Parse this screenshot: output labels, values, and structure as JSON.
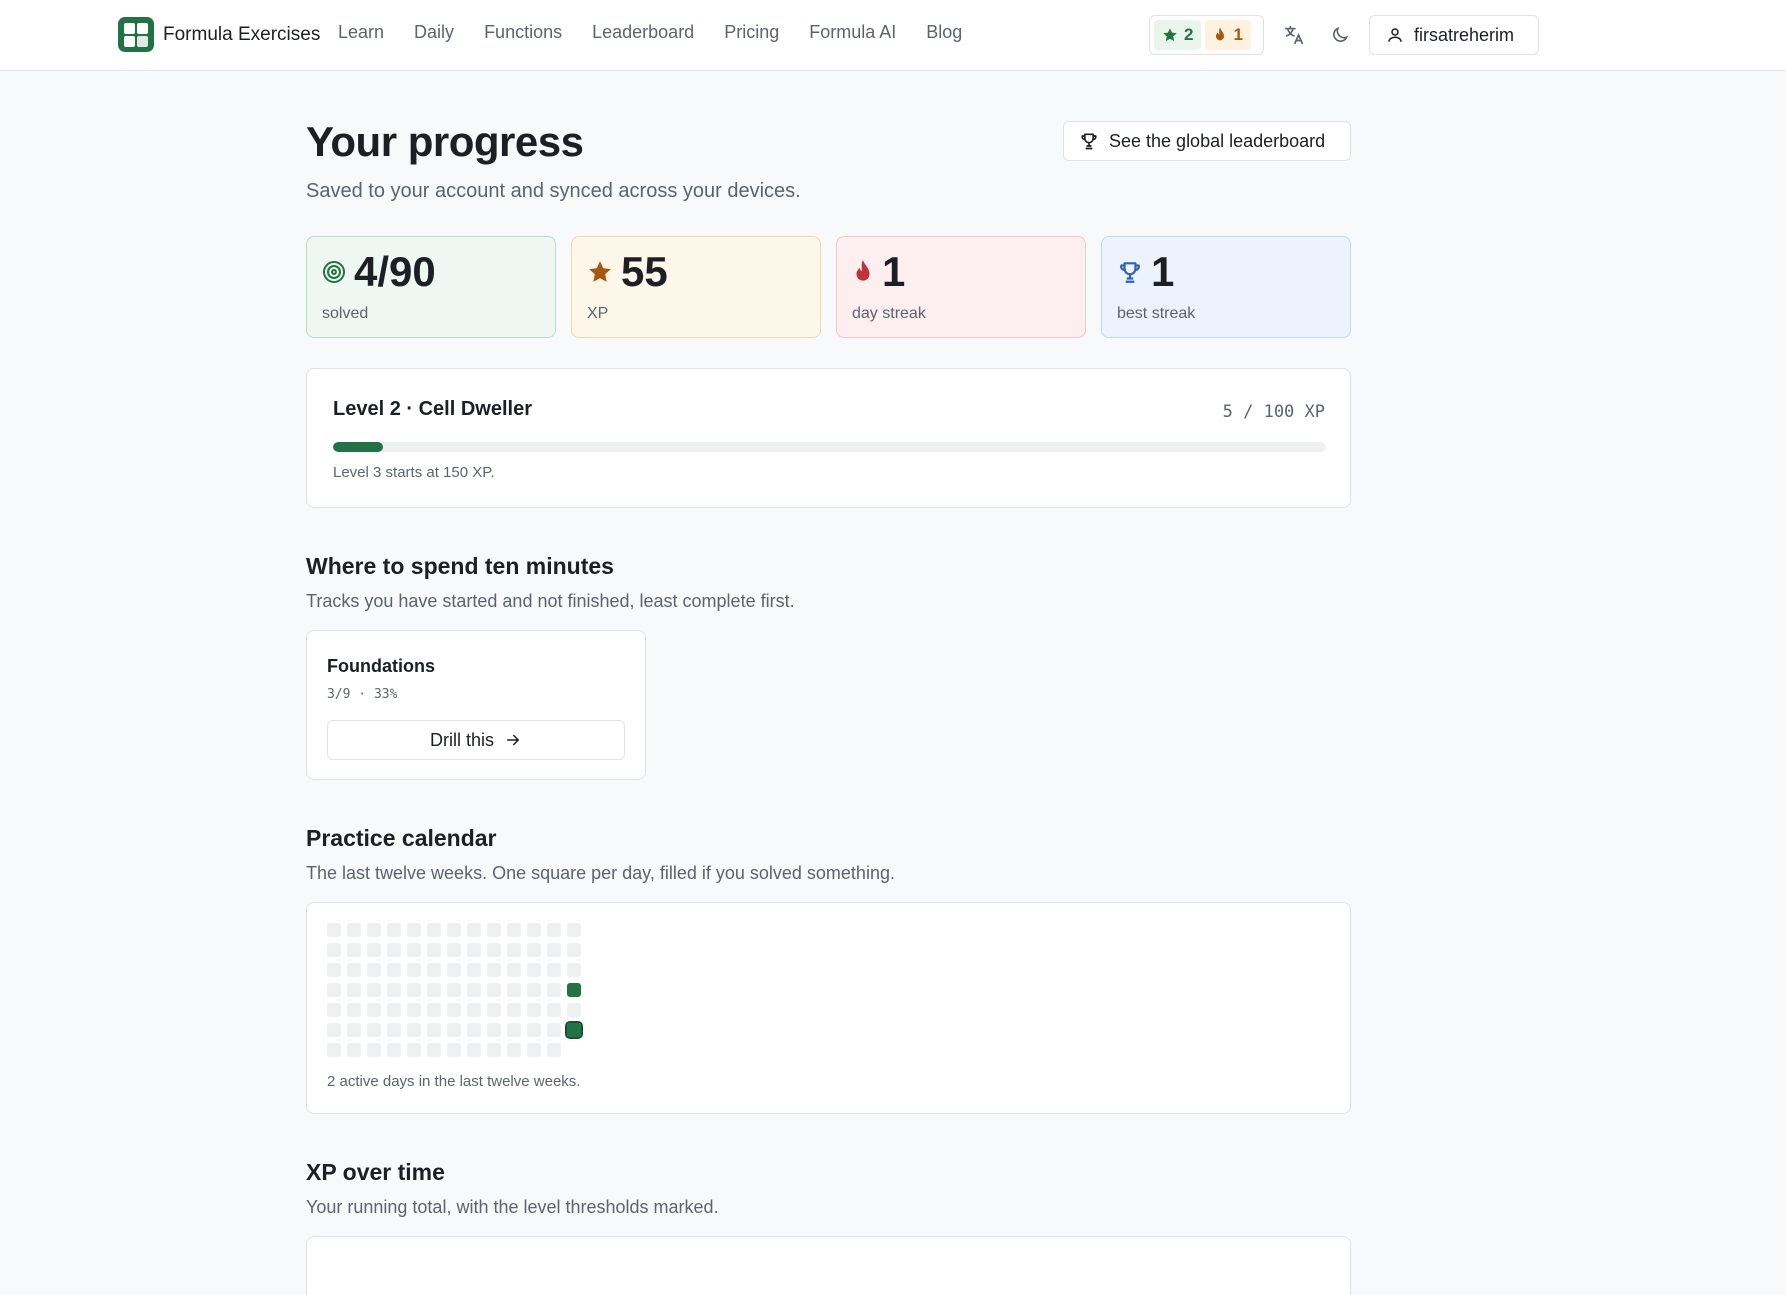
{
  "header": {
    "brand": "Formula Exercises",
    "nav": [
      "Learn",
      "Daily",
      "Functions",
      "Leaderboard",
      "Pricing",
      "Formula AI",
      "Blog"
    ],
    "stars": "2",
    "streak": "1",
    "username": "firsatreherim",
    "icons": [
      "star-icon",
      "flame-icon",
      "translate-icon",
      "moon-icon",
      "user-icon"
    ]
  },
  "page": {
    "title": "Your progress",
    "subtitle": "Saved to your account and synced across your devices.",
    "leaderboard_button": "See the global leaderboard"
  },
  "stats": [
    {
      "value": "4/90",
      "label": "solved",
      "icon": "target-icon"
    },
    {
      "value": "55",
      "label": "XP",
      "icon": "star-icon"
    },
    {
      "value": "1",
      "label": "day streak",
      "icon": "flame-icon"
    },
    {
      "value": "1",
      "label": "best streak",
      "icon": "trophy-icon"
    }
  ],
  "level": {
    "title": "Level 2 · Cell Dweller",
    "xp": "5 / 100 XP",
    "progress": 0.05,
    "note": "Level 3 starts at 150 XP."
  },
  "spend": {
    "title": "Where to spend ten minutes",
    "subtitle": "Tracks you have started and not finished, least complete first.",
    "track": {
      "name": "Foundations",
      "meta": "3/9 · 33%",
      "button": "Drill this"
    }
  },
  "calendar": {
    "title": "Practice calendar",
    "subtitle": "The last twelve weeks. One square per day, filled if you solved something.",
    "weeks": 13,
    "active": [
      {
        "week": 12,
        "day": 3
      },
      {
        "week": 12,
        "day": 5,
        "today": true
      }
    ],
    "last_week_days": 6,
    "note": "2 active days in the last twelve weeks."
  },
  "xp_over_time": {
    "title": "XP over time",
    "subtitle": "Your running total, with the level thresholds marked."
  },
  "colors": {
    "accent": "#217346",
    "xp": "#a6570f",
    "streak": "#c0323a",
    "best": "#2f63b3"
  }
}
